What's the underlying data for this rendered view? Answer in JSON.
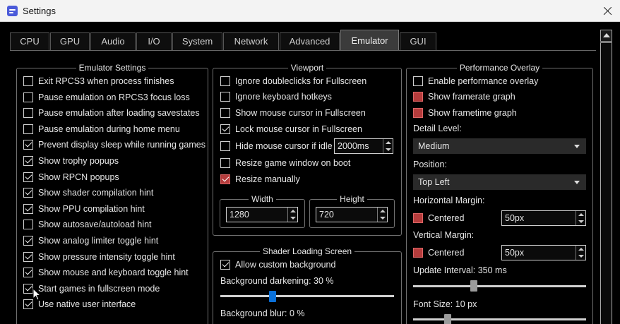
{
  "window": {
    "title": "Settings"
  },
  "tabs": [
    {
      "label": "CPU"
    },
    {
      "label": "GPU"
    },
    {
      "label": "Audio"
    },
    {
      "label": "I/O"
    },
    {
      "label": "System"
    },
    {
      "label": "Network"
    },
    {
      "label": "Advanced"
    },
    {
      "label": "Emulator",
      "active": true
    },
    {
      "label": "GUI"
    }
  ],
  "emulator_settings": {
    "title": "Emulator Settings",
    "items": [
      {
        "label": "Exit RPCS3 when process finishes",
        "checked": false
      },
      {
        "label": "Pause emulation on RPCS3 focus loss",
        "checked": false
      },
      {
        "label": "Pause emulation after loading savestates",
        "checked": false
      },
      {
        "label": "Pause emulation during home menu",
        "checked": false
      },
      {
        "label": "Prevent display sleep while running games",
        "checked": true
      },
      {
        "label": "Show trophy popups",
        "checked": true
      },
      {
        "label": "Show RPCN popups",
        "checked": true
      },
      {
        "label": "Show shader compilation hint",
        "checked": true
      },
      {
        "label": "Show PPU compilation hint",
        "checked": true
      },
      {
        "label": "Show autosave/autoload hint",
        "checked": false
      },
      {
        "label": "Show analog limiter toggle hint",
        "checked": true
      },
      {
        "label": "Show pressure intensity toggle hint",
        "checked": true
      },
      {
        "label": "Show mouse and keyboard toggle hint",
        "checked": true
      },
      {
        "label": "Start games in fullscreen mode",
        "checked": true
      },
      {
        "label": "Use native user interface",
        "checked": true
      }
    ]
  },
  "viewport": {
    "title": "Viewport",
    "items": [
      {
        "label": "Ignore doubleclicks for Fullscreen",
        "checked": false
      },
      {
        "label": "Ignore keyboard hotkeys",
        "checked": false
      },
      {
        "label": "Show mouse cursor in Fullscreen",
        "checked": false
      },
      {
        "label": "Lock mouse cursor in Fullscreen",
        "checked": true
      },
      {
        "label": "Hide mouse cursor if idle",
        "checked": false
      },
      {
        "label": "Resize game window on boot",
        "checked": false
      },
      {
        "label": "Resize manually",
        "checked": true
      }
    ],
    "idle_value": "2000ms",
    "width": {
      "title": "Width",
      "value": "1280"
    },
    "height": {
      "title": "Height",
      "value": "720"
    }
  },
  "shader_loading": {
    "title": "Shader Loading Screen",
    "allow_custom_bg": "Allow custom background",
    "allow_custom_bg_checked": true,
    "darkening_label": "Background darkening: 30 %",
    "darkening_value": 30,
    "blur_label": "Background blur: 0 %"
  },
  "performance_overlay": {
    "title": "Performance Overlay",
    "enable": {
      "label": "Enable performance overlay",
      "checked": false
    },
    "framerate": {
      "label": "Show framerate graph",
      "checked": false
    },
    "frametime": {
      "label": "Show frametime graph",
      "checked": false
    },
    "detail_level_label": "Detail Level:",
    "detail_level_value": "Medium",
    "position_label": "Position:",
    "position_value": "Top Left",
    "h_margin_label": "Horizontal Margin:",
    "h_centered": "Centered",
    "h_margin_value": "50px",
    "v_margin_label": "Vertical Margin:",
    "v_centered": "Centered",
    "v_margin_value": "50px",
    "update_interval_label": "Update Interval: 350 ms",
    "font_size_label": "Font Size: 10 px"
  },
  "colors": {
    "accent": "#0a70d8",
    "disabled_checkbox": "#b53c3c",
    "active_tab": "#3b3b3b"
  }
}
